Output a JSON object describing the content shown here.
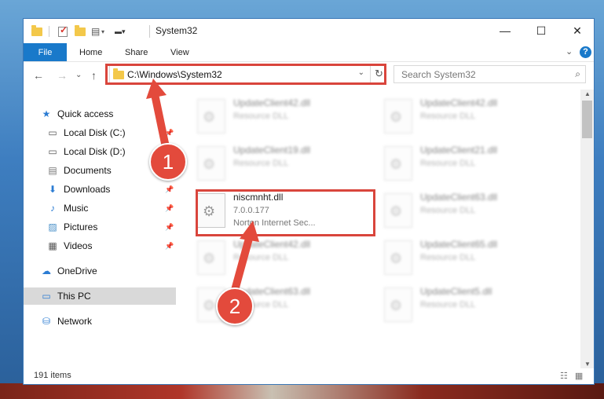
{
  "window": {
    "title": "System32",
    "controls": {
      "minimize": "—",
      "maximize": "☐",
      "close": "✕"
    }
  },
  "ribbon": {
    "file": "File",
    "tabs": [
      "Home",
      "Share",
      "View"
    ],
    "expand": "⌄",
    "help": "?"
  },
  "nav": {
    "back": "←",
    "forward": "→",
    "recent": "⌄",
    "up": "↑",
    "address": "C:\\Windows\\System32",
    "address_dropdown": "⌄",
    "refresh": "↻",
    "search_placeholder": "Search System32",
    "search_icon": "search-icon"
  },
  "sidebar": {
    "items": [
      {
        "label": "Quick access",
        "icon": "star-icon",
        "pinned": false
      },
      {
        "label": "Local Disk (C:)",
        "icon": "drive-icon",
        "pinned": true
      },
      {
        "label": "Local Disk (D:)",
        "icon": "drive-icon",
        "pinned": true
      },
      {
        "label": "Documents",
        "icon": "document-icon",
        "pinned": true
      },
      {
        "label": "Downloads",
        "icon": "download-icon",
        "pinned": true
      },
      {
        "label": "Music",
        "icon": "music-icon",
        "pinned": true
      },
      {
        "label": "Pictures",
        "icon": "pictures-icon",
        "pinned": true
      },
      {
        "label": "Videos",
        "icon": "videos-icon",
        "pinned": true
      },
      {
        "label": "OneDrive",
        "icon": "cloud-icon",
        "pinned": false
      },
      {
        "label": "This PC",
        "icon": "computer-icon",
        "pinned": false,
        "selected": true
      },
      {
        "label": "Network",
        "icon": "network-icon",
        "pinned": false
      }
    ]
  },
  "files": [
    {
      "name": "UpdateClient42.dll",
      "line2": "Resource DLL",
      "blurred": true
    },
    {
      "name": "UpdateClient42.dll",
      "line2": "Resource DLL",
      "blurred": true
    },
    {
      "name": "UpdateClient19.dll",
      "line2": "Resource DLL",
      "blurred": true
    },
    {
      "name": "UpdateClient21.dll",
      "line2": "Resource DLL",
      "blurred": true
    },
    {
      "name": "niscmnht.dll",
      "line2": "7.0.0.177",
      "line3": "Norton Internet Sec...",
      "blurred": false
    },
    {
      "name": "UpdateClient63.dll",
      "line2": "Resource DLL",
      "blurred": true
    },
    {
      "name": "UpdateClient42.dll",
      "line2": "Resource DLL",
      "blurred": true
    },
    {
      "name": "UpdateClient65.dll",
      "line2": "Resource DLL",
      "blurred": true
    },
    {
      "name": "UpdateClient63.dll",
      "line2": "Resource DLL",
      "blurred": true
    },
    {
      "name": "UpdateClient5.dll",
      "line2": "Resource DLL",
      "blurred": true
    }
  ],
  "status": {
    "item_count": "191 items",
    "views": "☷ ▦"
  },
  "callouts": [
    "1",
    "2"
  ],
  "colors": {
    "accent": "#1979ca",
    "highlight": "#d9453c",
    "callout": "#e34a3c"
  }
}
